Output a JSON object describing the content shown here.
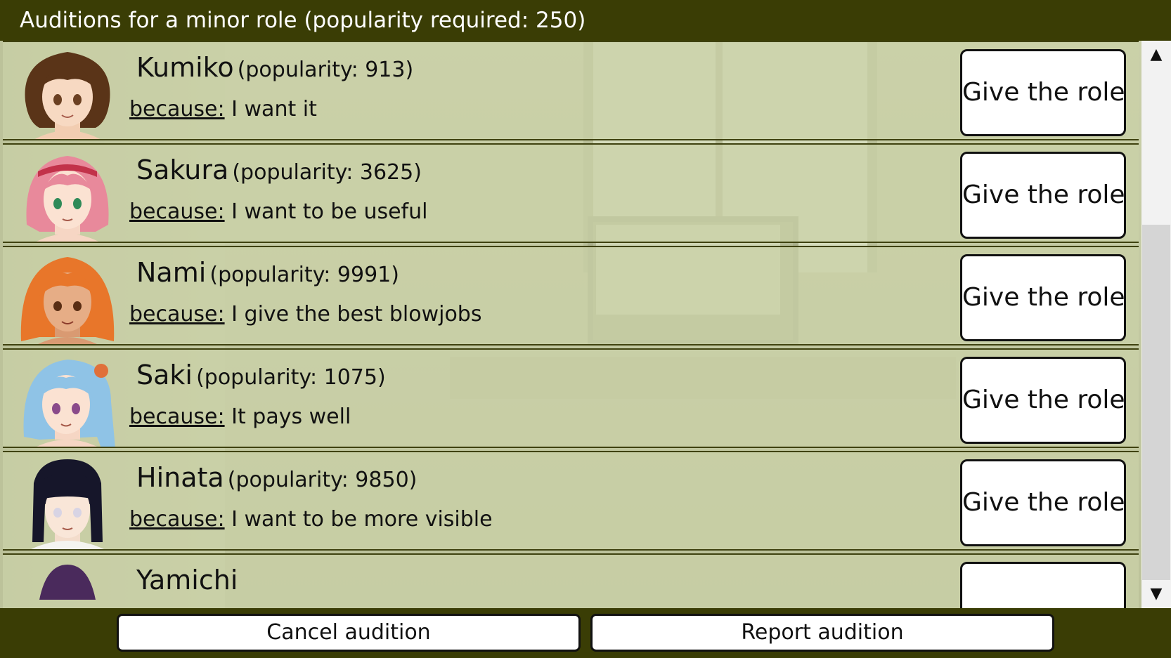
{
  "header": {
    "title": "Auditions for a minor role (popularity required: 250)"
  },
  "auditions": [
    {
      "name": "Kumiko",
      "popularity": "(popularity: 913)",
      "because_label": "because:",
      "reason": "I want it",
      "button_label": "Give the role"
    },
    {
      "name": "Sakura",
      "popularity": "(popularity: 3625)",
      "because_label": "because:",
      "reason": "I want to be useful",
      "button_label": "Give the role"
    },
    {
      "name": "Nami",
      "popularity": "(popularity: 9991)",
      "because_label": "because:",
      "reason": "I give the best blowjobs",
      "button_label": "Give the role"
    },
    {
      "name": "Saki",
      "popularity": "(popularity: 1075)",
      "because_label": "because:",
      "reason": "It pays well",
      "button_label": "Give the role"
    },
    {
      "name": "Hinata",
      "popularity": "(popularity: 9850)",
      "because_label": "because:",
      "reason": "I want to be more visible",
      "button_label": "Give the role"
    }
  ],
  "partial_row": {
    "name": "Yamichi",
    "button_label": ""
  },
  "scrollbar": {
    "up_icon": "▲",
    "down_icon": "▼"
  },
  "footer": {
    "cancel_label": "Cancel audition",
    "report_label": "Report audition"
  },
  "hair_colors": [
    "#5a3418",
    "#e8899b",
    "#e8762a",
    "#8fc3e6",
    "#16162a",
    "#4a2a5c"
  ]
}
